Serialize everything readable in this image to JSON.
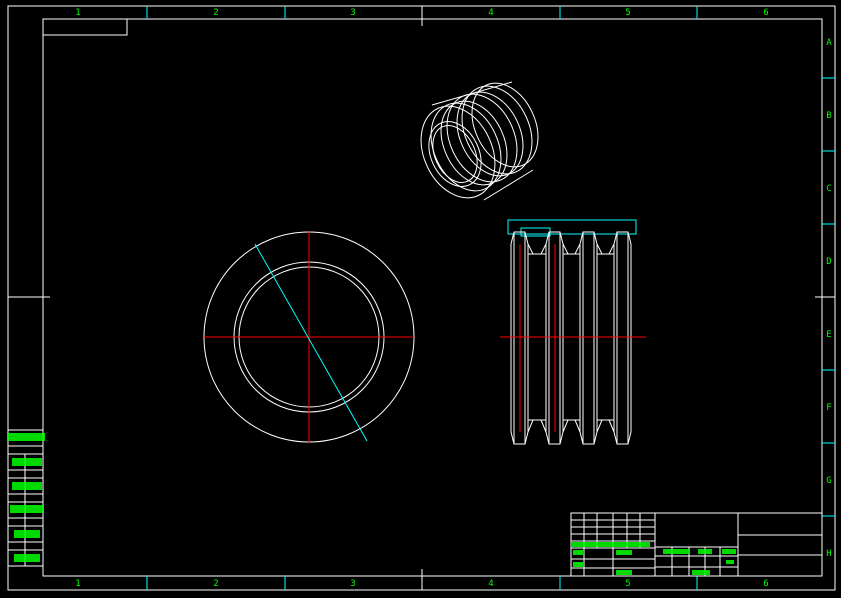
{
  "drawing": {
    "colors": {
      "background": "#000000",
      "frame": "#ffffff",
      "zone_labels": "#00ff00",
      "zone_lines": "#00ffff",
      "centerline": "#ff0000",
      "construction": "#00ffff",
      "part_outline": "#ffffff",
      "title_block_text": "#00ff00"
    },
    "zones": {
      "columns_top": [
        "1",
        "2",
        "3",
        "4",
        "5",
        "6"
      ],
      "columns_bottom": [
        "1",
        "2",
        "3",
        "4",
        "5",
        "6"
      ],
      "rows_right": [
        "A",
        "B",
        "C",
        "D",
        "E",
        "F",
        "G",
        "H"
      ]
    },
    "views": {
      "iso": "isometric-view",
      "end": "end-view",
      "side": "side-view"
    }
  }
}
